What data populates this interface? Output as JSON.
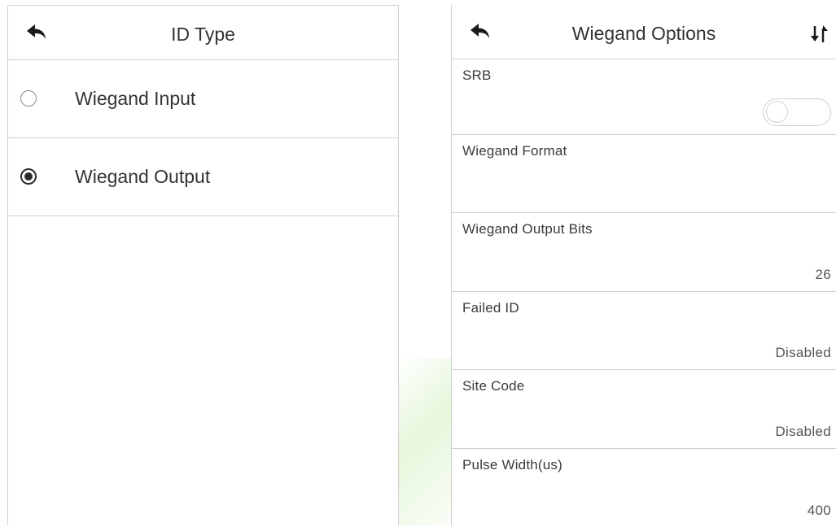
{
  "id_type": {
    "title": "ID Type",
    "options": [
      {
        "label": "Wiegand Input",
        "selected": false
      },
      {
        "label": "Wiegand Output",
        "selected": true
      }
    ]
  },
  "wiegand_options": {
    "title": "Wiegand Options",
    "rows": [
      {
        "label": "SRB",
        "toggle": false
      },
      {
        "label": "Wiegand Format",
        "value": ""
      },
      {
        "label": "Wiegand Output Bits",
        "value": "26"
      },
      {
        "label": "Failed ID",
        "value": "Disabled"
      },
      {
        "label": "Site Code",
        "value": "Disabled"
      },
      {
        "label": "Pulse Width(us)",
        "value": "400"
      }
    ]
  },
  "icons": {
    "back": "back-arrow-icon",
    "sort": "sort-arrows-icon"
  },
  "colors": {
    "divider": "#cfcfcf",
    "text": "#333333",
    "radio_checked": "#2b2b2b"
  }
}
